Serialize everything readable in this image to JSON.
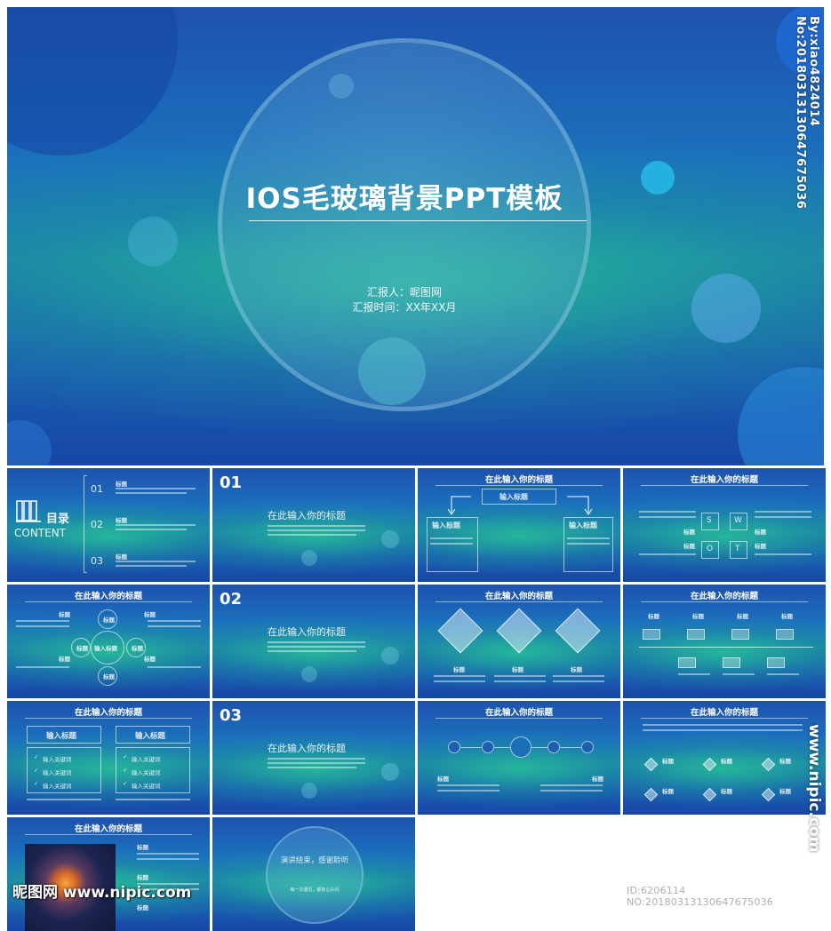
{
  "hero": {
    "title": "IOS毛玻璃背景PPT模板",
    "reporter": "汇报人：昵图网",
    "report_time": "汇报时间：XX年XX月",
    "watermark_vertical": "By:xiao4824014 No:20180313130647675036"
  },
  "slides": {
    "toc": {
      "title": "目录",
      "subtitle": "CONTENT",
      "nums": [
        "01",
        "02",
        "03"
      ],
      "item_label": "标题"
    },
    "section1": {
      "num": "01",
      "title": "在此输入你的标题"
    },
    "section2": {
      "num": "02",
      "title": "在此输入你的标题"
    },
    "section3": {
      "num": "03",
      "title": "在此输入你的标题"
    },
    "flow": {
      "title": "在此输入你的标题",
      "center_box": "输入标题",
      "left_box": "输入标题",
      "right_box": "输入标题"
    },
    "swot": {
      "title": "在此输入你的标题",
      "letters": [
        "S",
        "W",
        "O",
        "T"
      ],
      "label": "标题"
    },
    "cycle": {
      "title": "在此输入你的标题",
      "center": "输入标题",
      "node": "标题",
      "label": "标题"
    },
    "diamonds": {
      "title": "在此输入你的标题",
      "label": "标题"
    },
    "timeline": {
      "title": "在此输入你的标题",
      "label": "标题"
    },
    "compare": {
      "title": "在此输入你的标题",
      "left": "输入标题",
      "right": "输入标题",
      "keyword": "输入关键词"
    },
    "icons_row": {
      "title": "在此输入你的标题",
      "label": "标题"
    },
    "diamond_list": {
      "title": "在此输入你的标题",
      "label": "标题"
    },
    "photo": {
      "title": "在此输入你的标题",
      "label": "标题"
    },
    "end": {
      "title": "演讲结束，感谢聆听",
      "sub": "每一次遇见，都有心头闪"
    }
  },
  "watermarks": {
    "logo": "昵图网 www.nipic.com",
    "id_line": "ID:6206114 NO:20180313130647675036",
    "side": "www.nipic.com"
  }
}
